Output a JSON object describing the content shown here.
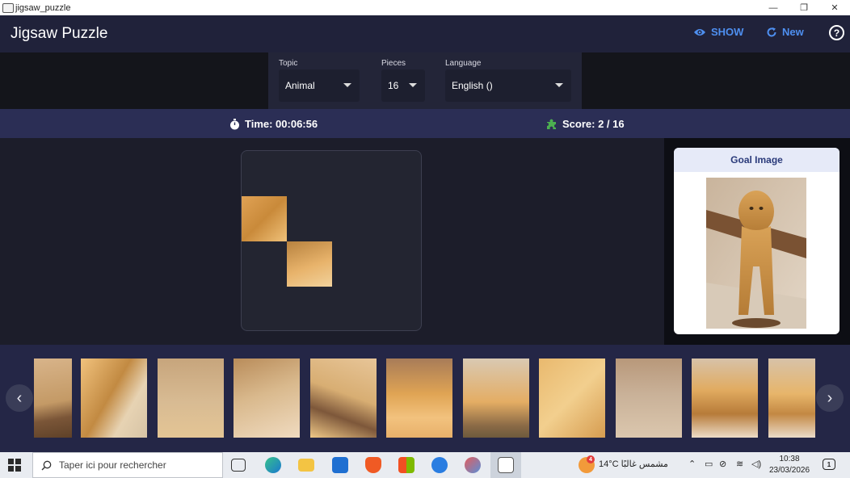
{
  "window": {
    "title": "jigsaw_puzzle",
    "minimize": "—",
    "restore": "❐",
    "close": "✕"
  },
  "appbar": {
    "title": "Jigsaw Puzzle",
    "show_label": "SHOW",
    "new_label": "New",
    "help_label": "?"
  },
  "settings": {
    "topic_label": "Topic",
    "topic_value": "Animal",
    "pieces_label": "Pieces",
    "pieces_value": "16",
    "language_label": "Language",
    "language_value": "English ()"
  },
  "status": {
    "time_text": "Time: 00:06:56",
    "score_text": "Score: 2 / 16"
  },
  "goal": {
    "heading": "Goal Image"
  },
  "tray": {
    "prev_icon": "‹",
    "next_icon": "›"
  },
  "taskbar": {
    "search_placeholder": "Taper ici pour rechercher",
    "weather_text": "14°C  مشمس غالبًا",
    "weather_badge": "4",
    "time": "10:38",
    "date": "23/03/2026",
    "notification_count": "1"
  },
  "colors": {
    "accent": "#4e8ff0",
    "app_bg": "#20223a",
    "status_bg": "#2b2e55",
    "tray_bg": "#242646"
  }
}
